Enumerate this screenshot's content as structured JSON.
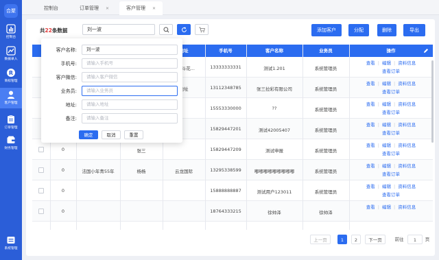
{
  "sidebar": {
    "logo": "合聚",
    "items": [
      {
        "label": "控制台",
        "icon": "bar-chart-icon"
      },
      {
        "label": "数据录入",
        "icon": "trend-icon"
      },
      {
        "label": "商标管理",
        "icon": "registered-mark-icon"
      },
      {
        "label": "客户管理",
        "icon": "person-icon"
      },
      {
        "label": "订单管理",
        "icon": "clipboard-icon"
      },
      {
        "label": "财务管理",
        "icon": "wallet-icon"
      },
      {
        "label": "系统管理",
        "icon": "settings-box-icon"
      }
    ],
    "active_index": 3
  },
  "tabs": [
    {
      "label": "控制台",
      "closable": false
    },
    {
      "label": "订单管理",
      "closable": true
    },
    {
      "label": "客户管理",
      "closable": true
    }
  ],
  "toolbar": {
    "count_prefix": "共",
    "count": "22",
    "count_suffix": "条数据",
    "search_value": "刘一波",
    "add_label": "添加客户",
    "assign_label": "分配",
    "delete_label": "删除",
    "export_label": "导出"
  },
  "table": {
    "headers": [
      "",
      "",
      "",
      "",
      "地址",
      "手机号",
      "客户名称",
      "业务员",
      "操作"
    ],
    "op_labels": {
      "view": "查看",
      "edit": "编辑",
      "info": "资料信息",
      "order": "查看订单"
    },
    "rows": [
      {
        "c2": "",
        "c3": "",
        "c4": "",
        "addr": "...翻斗花...",
        "phone": "13333333331",
        "name": "测试1.201",
        "sales": "系统管理员"
      },
      {
        "c2": "",
        "c3": "",
        "c4": "",
        "addr": "地址",
        "phone": "13112348785",
        "name": "张三拉彩有限公司",
        "sales": "系统管理员"
      },
      {
        "c2": "",
        "c3": "",
        "c4": "",
        "addr": "",
        "phone": "15553330000",
        "name": "??",
        "sales": "系统管理员"
      },
      {
        "c2": "",
        "c3": "",
        "c4": "",
        "addr": "",
        "phone": "15829447201",
        "name": "测试42005407",
        "sales": "系统管理员"
      },
      {
        "c2": "0",
        "c3": "",
        "c4": "张三",
        "addr": "",
        "phone": "15829447209",
        "name": "测试申报",
        "sales": "系统管理员"
      },
      {
        "c2": "0",
        "c3": "法国小年青55年",
        "c4": "杨杨",
        "addr": "云龙国际",
        "phone": "13295338599",
        "name": "嘟嘟嘟嘟嘟嘟嘟嘟嘟",
        "sales": "系统管理员"
      },
      {
        "c2": "0",
        "c3": "",
        "c4": "",
        "addr": "",
        "phone": "15888888887",
        "name": "测试用户123011",
        "sales": "系统管理员"
      },
      {
        "c2": "0",
        "c3": "",
        "c4": "",
        "addr": "",
        "phone": "18764333215",
        "name": "徐帅泽",
        "sales": "徐帅泽"
      }
    ]
  },
  "pagination": {
    "prev": "上一页",
    "pages": [
      "1",
      "2"
    ],
    "current": "1",
    "next": "下一页",
    "goto_label": "前往",
    "goto_value": "1",
    "page_unit": "页"
  },
  "filter": {
    "fields": [
      {
        "label": "客户名称:",
        "value": "刘一波",
        "placeholder": ""
      },
      {
        "label": "手机号:",
        "value": "",
        "placeholder": "请输入手机号"
      },
      {
        "label": "客户微信:",
        "value": "",
        "placeholder": "请输入客户微信"
      },
      {
        "label": "业务员:",
        "value": "",
        "placeholder": "请输入业务员"
      },
      {
        "label": "地址:",
        "value": "",
        "placeholder": "请输入地址"
      },
      {
        "label": "备注:",
        "value": "",
        "placeholder": "请输入备注"
      }
    ],
    "confirm": "确定",
    "cancel": "取消",
    "reset": "重置"
  },
  "colors": {
    "primary": "#2b6cf0",
    "sidebar": "#2b5ed8",
    "count_red": "#e23c3c"
  }
}
